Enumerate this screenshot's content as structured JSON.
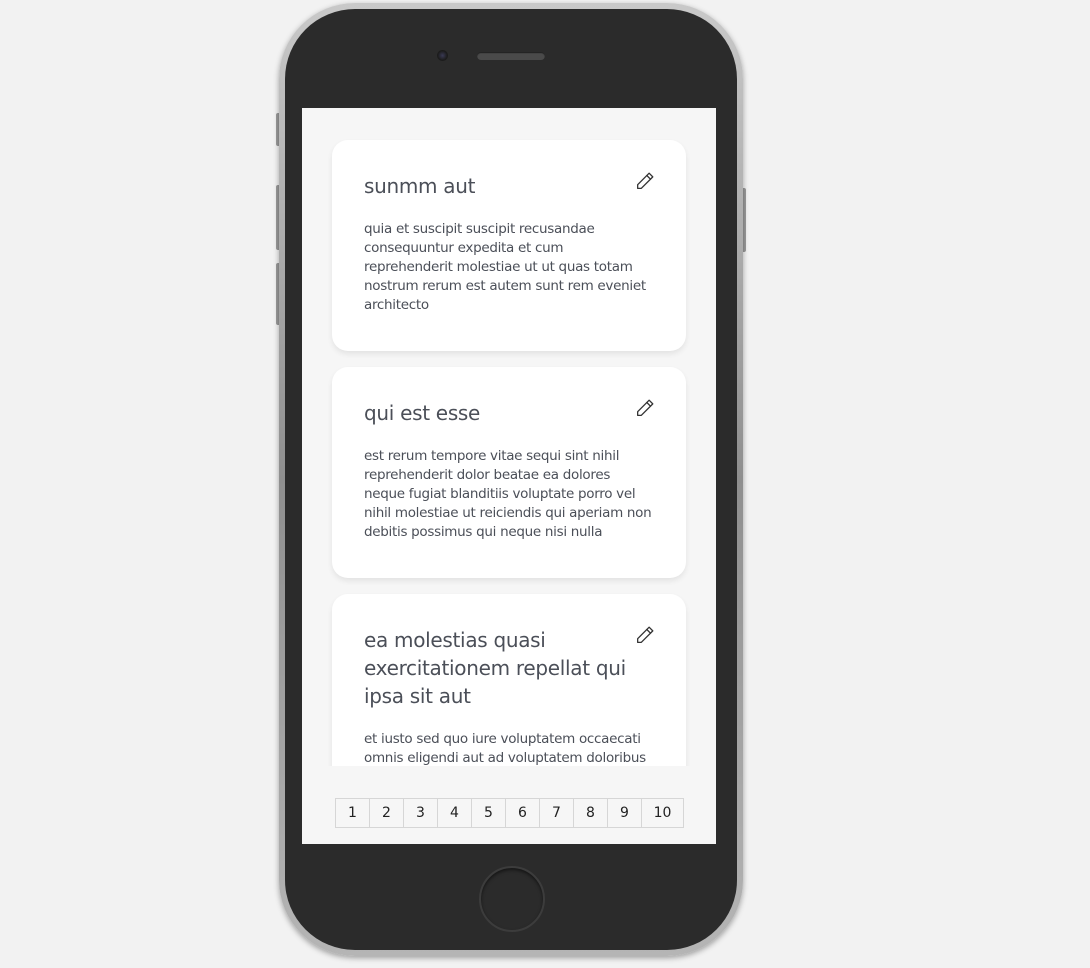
{
  "posts": [
    {
      "title": "sunmm aut",
      "body": "quia et suscipit suscipit recusandae consequuntur expedita et cum reprehenderit molestiae ut ut quas totam nostrum rerum est autem sunt rem eveniet architecto",
      "edit_icon": "pencil-icon"
    },
    {
      "title": "qui est esse",
      "body": "est rerum tempore vitae sequi sint nihil reprehenderit dolor beatae ea dolores neque fugiat blanditiis voluptate porro vel nihil molestiae ut reiciendis qui aperiam non debitis possimus qui neque nisi nulla",
      "edit_icon": "pencil-icon"
    },
    {
      "title": "ea molestias quasi exercitationem repellat qui ipsa sit aut",
      "body": "et iusto sed quo iure voluptatem occaecati omnis eligendi aut ad voluptatem doloribus vel accusantium quis pariatur",
      "edit_icon": "pencil-icon"
    }
  ],
  "pagination": {
    "pages": [
      "1",
      "2",
      "3",
      "4",
      "5",
      "6",
      "7",
      "8",
      "9",
      "10"
    ]
  },
  "colors": {
    "text": "#4b4f58",
    "screen_bg": "#f6f6f6",
    "card_bg": "#ffffff",
    "phone_body": "#2b2b2b"
  }
}
